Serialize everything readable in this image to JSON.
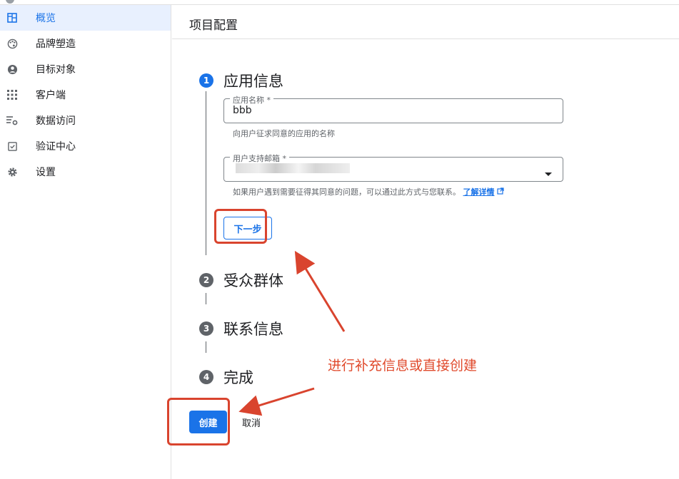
{
  "sidebar": {
    "items": [
      {
        "label": "概览",
        "icon": "dashboard-icon",
        "active": true
      },
      {
        "label": "品牌塑造",
        "icon": "palette-icon"
      },
      {
        "label": "目标对象",
        "icon": "person-icon"
      },
      {
        "label": "客户端",
        "icon": "grid-icon"
      },
      {
        "label": "数据访问",
        "icon": "list-settings-icon"
      },
      {
        "label": "验证中心",
        "icon": "check-box-icon"
      },
      {
        "label": "设置",
        "icon": "gear-icon"
      }
    ]
  },
  "header": {
    "title": "项目配置"
  },
  "steps": [
    {
      "number": "1",
      "title": "应用信息",
      "state": "active"
    },
    {
      "number": "2",
      "title": "受众群体",
      "state": "inactive"
    },
    {
      "number": "3",
      "title": "联系信息",
      "state": "inactive"
    },
    {
      "number": "4",
      "title": "完成",
      "state": "inactive"
    }
  ],
  "form": {
    "app_name_label": "应用名称 *",
    "app_name_value": "bbb",
    "app_name_helper": "向用户征求同意的应用的名称",
    "support_email_label": "用户支持邮箱 *",
    "support_email_helper": "如果用户遇到需要征得其同意的问题，可以通过此方式与您联系。",
    "learn_more_link": "了解详情",
    "next_button": "下一步"
  },
  "actions": {
    "create_button": "创建",
    "cancel_button": "取消"
  },
  "annotation": {
    "text": "进行补充信息或直接创建",
    "color": "#e04a2c"
  },
  "colors": {
    "accent": "#1a73e8",
    "annotation_red": "#d9442e"
  }
}
